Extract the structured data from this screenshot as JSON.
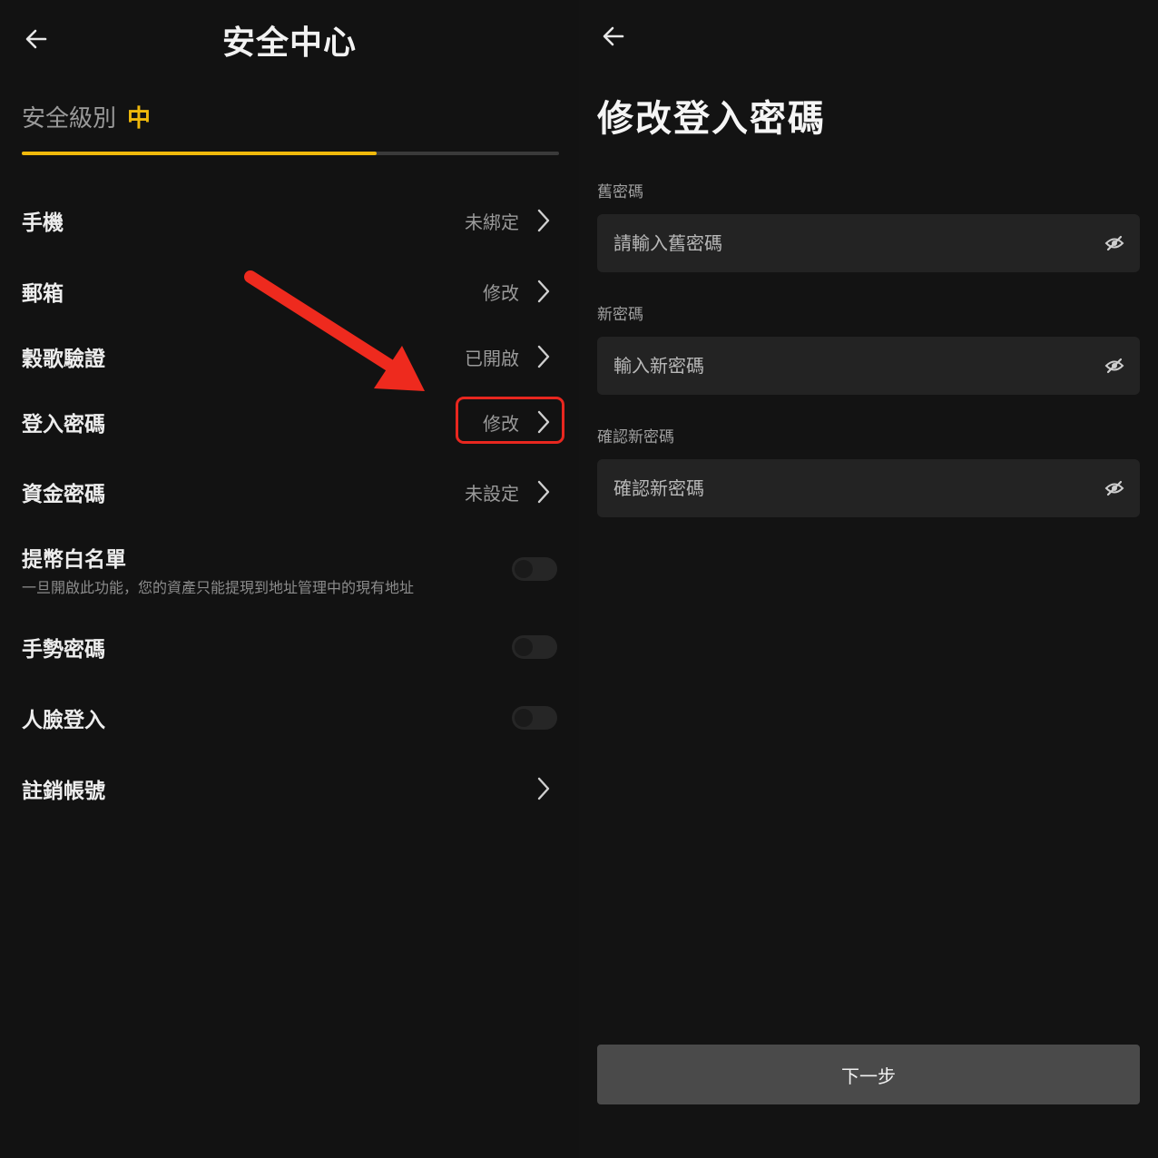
{
  "colors": {
    "background": "#121212",
    "accent": "#f0b90b",
    "highlight": "#e8271f",
    "field_bg": "#232323",
    "button_bg": "#4a4a4a"
  },
  "left": {
    "title": "安全中心",
    "security_level": {
      "label": "安全級別",
      "value": "中",
      "progress_fraction": 0.66
    },
    "rows": [
      {
        "label": "手機",
        "value": "未綁定",
        "type": "link"
      },
      {
        "label": "郵箱",
        "value": "修改",
        "type": "link"
      },
      {
        "label": "穀歌驗證",
        "value": "已開啟",
        "type": "link"
      },
      {
        "label": "登入密碼",
        "value": "修改",
        "type": "link",
        "highlighted": true
      },
      {
        "label": "資金密碼",
        "value": "未設定",
        "type": "link"
      },
      {
        "label": "提幣白名單",
        "sub": "一旦開啟此功能，您的資產只能提現到地址管理中的現有地址",
        "type": "toggle",
        "on": false
      },
      {
        "label": "手勢密碼",
        "type": "toggle",
        "on": false
      },
      {
        "label": "人臉登入",
        "type": "toggle",
        "on": false
      },
      {
        "label": "註銷帳號",
        "type": "link"
      }
    ]
  },
  "right": {
    "title": "修改登入密碼",
    "fields": [
      {
        "label": "舊密碼",
        "placeholder": "請輸入舊密碼"
      },
      {
        "label": "新密碼",
        "placeholder": "輸入新密碼"
      },
      {
        "label": "確認新密碼",
        "placeholder": "確認新密碼"
      }
    ],
    "next_button": "下一步"
  },
  "icons": {
    "back": "arrow-left-icon",
    "chevron": "chevron-right-icon",
    "eye": "eye-off-icon",
    "annotation": "red-arrow-annotation"
  }
}
